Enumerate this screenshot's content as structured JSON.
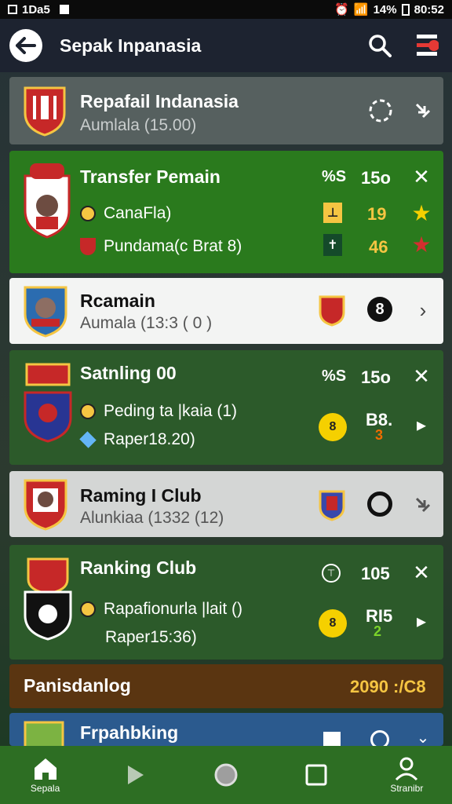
{
  "status": {
    "left": "1Da5",
    "battery": "14%",
    "time": "80:52"
  },
  "appbar": {
    "title": "Sepak Inpanasia"
  },
  "cards": {
    "c1": {
      "title": "Repafail Indanasia",
      "sub": "Aumlala (15.00)"
    },
    "c2": {
      "title": "Transfer Pemain",
      "stat_label": "%S",
      "stat_value": "15o",
      "row1": "CanaFla)",
      "row1_value": "19",
      "row2": "Pundama(c Brat 8)",
      "row2_value": "46"
    },
    "c3": {
      "title": "Rcamain",
      "sub": "Aumala (13:3 ( 0 )",
      "badge": "8"
    },
    "c4": {
      "title": "Satnling 00",
      "stat_label": "%S",
      "stat_value": "15o",
      "row1": "Peding ta |kaia (1)",
      "row2": "Raper18.20)",
      "value_a": "B8.",
      "value_b": "3"
    },
    "c5": {
      "title": "Raming I Club",
      "sub": "Alunkiaa (1332 (12)"
    },
    "c6": {
      "title": "Ranking Club",
      "stat_value": "105",
      "row1": "Rapafionurla |lait ()",
      "row2": "Raper15:36)",
      "value_a": "RI5",
      "value_b": "2"
    },
    "c7": {
      "title": "Panisdanlog",
      "value": "2090 :/C8"
    },
    "c8": {
      "title": "Frpahbking"
    }
  },
  "nav": {
    "home": "Sepala",
    "profile": "Stranibr"
  },
  "colors": {
    "accent_green": "#2a7a1d",
    "appbar": "#1d2330",
    "nav": "#2d6e23"
  }
}
